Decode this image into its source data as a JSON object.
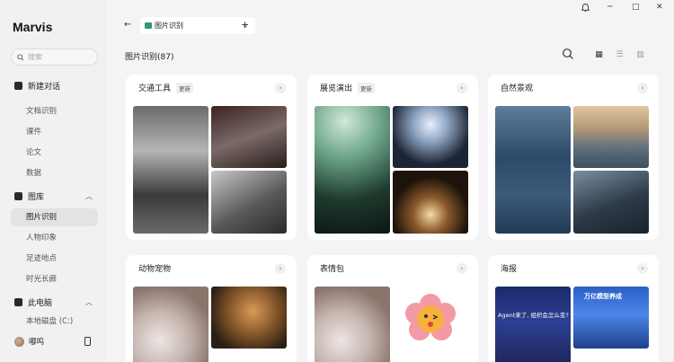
{
  "app": {
    "name": "Marvis"
  },
  "search": {
    "placeholder": "搜索"
  },
  "sidebar": {
    "new_chat": "新建对话",
    "items": [
      "文档识别",
      "课件",
      "论文",
      "数据"
    ],
    "gallery": "图库",
    "gallery_items": [
      "图片识别",
      "人物印象",
      "足迹地点",
      "时光长廊"
    ],
    "computer": "此电脑",
    "computer_items": [
      "本地磁盘 (C:)"
    ],
    "user": "嘟呜"
  },
  "tab": {
    "label": "图片识别"
  },
  "content": {
    "title": "图片识别(87)",
    "cards": [
      {
        "title": "交通工具",
        "badge": "更新"
      },
      {
        "title": "展览演出",
        "badge": "更新"
      },
      {
        "title": "自然景观",
        "badge": ""
      },
      {
        "title": "动物宠物",
        "badge": ""
      },
      {
        "title": "表情包",
        "badge": ""
      },
      {
        "title": "海报",
        "badge": ""
      }
    ],
    "poster_text": [
      "万亿模型养成",
      "Agent来了, 组织会怎么变?"
    ]
  },
  "colors": {
    "accent": "#2e9a72",
    "background": "#f4f4f6",
    "card": "#ffffff"
  }
}
